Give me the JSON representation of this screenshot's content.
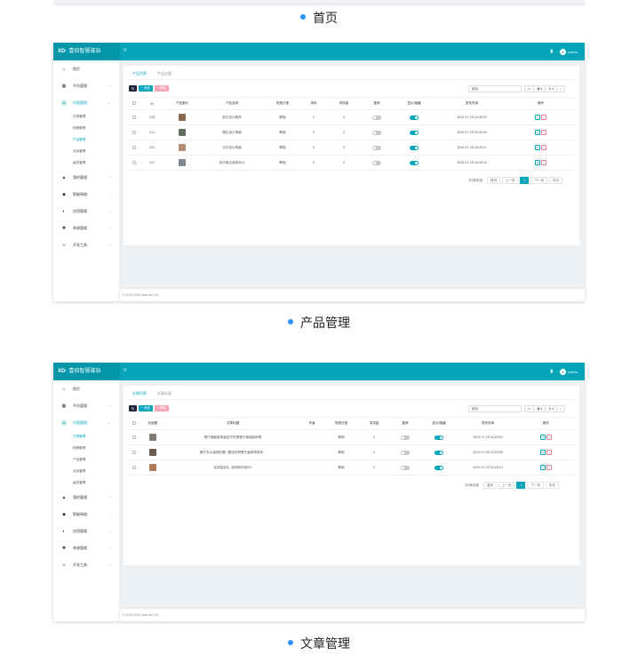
{
  "sections": [
    {
      "caption": "首页"
    },
    {
      "caption": "产品管理"
    },
    {
      "caption": "文章管理"
    }
  ],
  "app": {
    "brand_logo": "XD·",
    "brand_name": "壹佰智慧驿站",
    "menu_icon": "≡",
    "bell_icon": "▮",
    "user_name": "admin",
    "footer": "© 2019-2022 www.xd7.cn"
  },
  "sidebar": {
    "items": [
      {
        "icon": "home-icon",
        "glyph": "⌂",
        "label": "首页"
      },
      {
        "icon": "grid-icon",
        "glyph": "▦",
        "label": "平台管理",
        "arrow": "›"
      },
      {
        "icon": "document-icon",
        "glyph": "▤",
        "label": "内容管理",
        "arrow": "⌄"
      },
      {
        "icon": "bell-icon",
        "glyph": "▲",
        "label": "我的管理",
        "arrow": "›"
      },
      {
        "icon": "users-icon",
        "glyph": "◆",
        "label": "智能网络",
        "arrow": "›"
      },
      {
        "icon": "globe-icon",
        "glyph": "◐",
        "label": "应用管理",
        "arrow": "›"
      },
      {
        "icon": "gear-icon",
        "glyph": "✱",
        "label": "系统管理",
        "arrow": "›"
      },
      {
        "icon": "code-icon",
        "glyph": "‹›",
        "label": "开发工具",
        "arrow": "›"
      }
    ],
    "sub_items": [
      "文章管理",
      "相册管理",
      "产品管理",
      "活动管理",
      "留言管理"
    ]
  },
  "toolbar": {
    "refresh": "↻",
    "add": "+ 添加",
    "delete": "× 删除",
    "search_placeholder": "搜索",
    "tools": [
      "▭",
      "▦ ▾",
      "⬇ ▾",
      "⌕"
    ]
  },
  "product": {
    "tabs": [
      "产品列表",
      "产品分类"
    ],
    "active_tab": 0,
    "columns": [
      "",
      "ID",
      "产品图片",
      "产品名称",
      "所属分类",
      "排序",
      "浏览量",
      "推荐",
      "显示/隐藏",
      "发布时间",
      "操作"
    ],
    "rows": [
      {
        "id": "215",
        "thumb": "#8a6a4e",
        "name": "新式设计教师",
        "cat": "教程",
        "sort": "0",
        "views": "0",
        "rec": false,
        "show": true,
        "time": "2019-07-29 16:26:03"
      },
      {
        "id": "214",
        "thumb": "#5f6f5a",
        "name": "理论设计风格",
        "cat": "教程",
        "sort": "0",
        "views": "0",
        "rec": false,
        "show": true,
        "time": "2019-07-29 16:25:49"
      },
      {
        "id": "213",
        "thumb": "#b58d6e",
        "name": "日式设计风格",
        "cat": "教程",
        "sort": "0",
        "views": "0",
        "rec": false,
        "show": true,
        "time": "2019-07-29 16:25:27"
      },
      {
        "id": "212",
        "thumb": "#7d8894",
        "name": "现代简洁装修设计",
        "cat": "教程",
        "sort": "0",
        "views": "0",
        "rec": false,
        "show": true,
        "time": "2019-07-29 16:25:16"
      }
    ],
    "total": "共4条信息"
  },
  "article": {
    "tabs": [
      "文章列表",
      "文章分类"
    ],
    "active_tab": 0,
    "columns": [
      "",
      "封面图",
      "文章标题",
      "作者",
      "所属分类",
      "浏览量",
      "推荐",
      "显示/隐藏",
      "发布时间",
      "操作"
    ],
    "rows": [
      {
        "thumb": "#7e7a74",
        "title": "餐厅墙面装饰画挂不好是餐厅墙面装修难",
        "author": "",
        "cat": "教程",
        "views": "0",
        "rec": false,
        "show": true,
        "time": "2019-07-29 16:29:53"
      },
      {
        "thumb": "#6b5d52",
        "title": "餐厅怎么装修好看? 要如何把餐厅装修得有风...",
        "author": "",
        "cat": "教程",
        "views": "0",
        "rec": false,
        "show": true,
        "time": "2019-07-29 16:29:36"
      },
      {
        "thumb": "#b07a5c",
        "title": "油漆金用久, 如何刷好如何?",
        "author": "",
        "cat": "教程",
        "views": "0",
        "rec": false,
        "show": true,
        "time": "2019-07-29 16:29:12"
      }
    ],
    "total": "共3条信息"
  },
  "pager": {
    "first": "首页",
    "prev": "上一页",
    "current": "1",
    "next": "下一页",
    "last": "末页"
  },
  "colors": {
    "accent": "#04a5b9",
    "bullet": "#2e90fa",
    "danger": "#f08097"
  }
}
